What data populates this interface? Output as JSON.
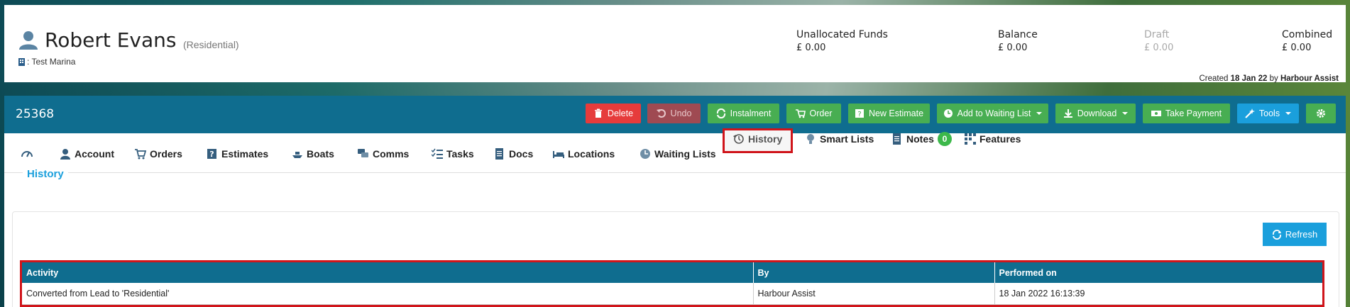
{
  "profile": {
    "name": "Robert Evans",
    "type": "(Residential)",
    "marina": ": Test Marina",
    "financials": [
      {
        "label": "Unallocated Funds",
        "value": "£ 0.00"
      },
      {
        "label": "Balance",
        "value": "£ 0.00"
      },
      {
        "label": "Draft",
        "value": "£ 0.00"
      },
      {
        "label": "Combined",
        "value": "£ 0.00"
      }
    ],
    "created": {
      "prefix": "Created",
      "date": "18 Jan 22",
      "by_word": "by",
      "by": "Harbour Assist"
    }
  },
  "toolbar": {
    "account_id": "25368",
    "buttons": [
      {
        "label": "Delete"
      },
      {
        "label": "Undo"
      },
      {
        "label": "Instalment"
      },
      {
        "label": "Order"
      },
      {
        "label": "New Estimate"
      },
      {
        "label": "Add to Waiting List"
      },
      {
        "label": "Download"
      },
      {
        "label": "Take Payment"
      },
      {
        "label": "Tools"
      }
    ],
    "colors": {
      "red": "#e63b3b",
      "green": "#48ae52",
      "blue": "#1a9fdc",
      "bar": "#0f6d8f"
    }
  },
  "tabs": [
    {
      "label": "",
      "icon": "dashboard-icon"
    },
    {
      "label": "Account",
      "icon": "user-icon"
    },
    {
      "label": "Orders",
      "icon": "cart-icon"
    },
    {
      "label": "Estimates",
      "icon": "question-icon"
    },
    {
      "label": "Boats",
      "icon": "boat-icon"
    },
    {
      "label": "Comms",
      "icon": "comments-icon"
    },
    {
      "label": "Tasks",
      "icon": "tasks-icon"
    },
    {
      "label": "Docs",
      "icon": "doc-icon"
    },
    {
      "label": "Locations",
      "icon": "bed-icon"
    },
    {
      "label": "Waiting Lists",
      "icon": "clock-icon"
    },
    {
      "label": "History",
      "icon": "history-icon",
      "active": true
    },
    {
      "label": "Smart Lists",
      "icon": "lightbulb-icon"
    },
    {
      "label": "Notes",
      "icon": "note-icon",
      "badge": "0"
    },
    {
      "label": "Features",
      "icon": "grid-icon"
    }
  ],
  "history": {
    "title": "History",
    "refresh_label": "Refresh",
    "columns": [
      "Activity",
      "By",
      "Performed on"
    ],
    "rows": [
      {
        "activity": "Converted from Lead to 'Residential'",
        "by": "Harbour Assist",
        "performed_on": "18 Jan 2022 16:13:39"
      }
    ]
  }
}
